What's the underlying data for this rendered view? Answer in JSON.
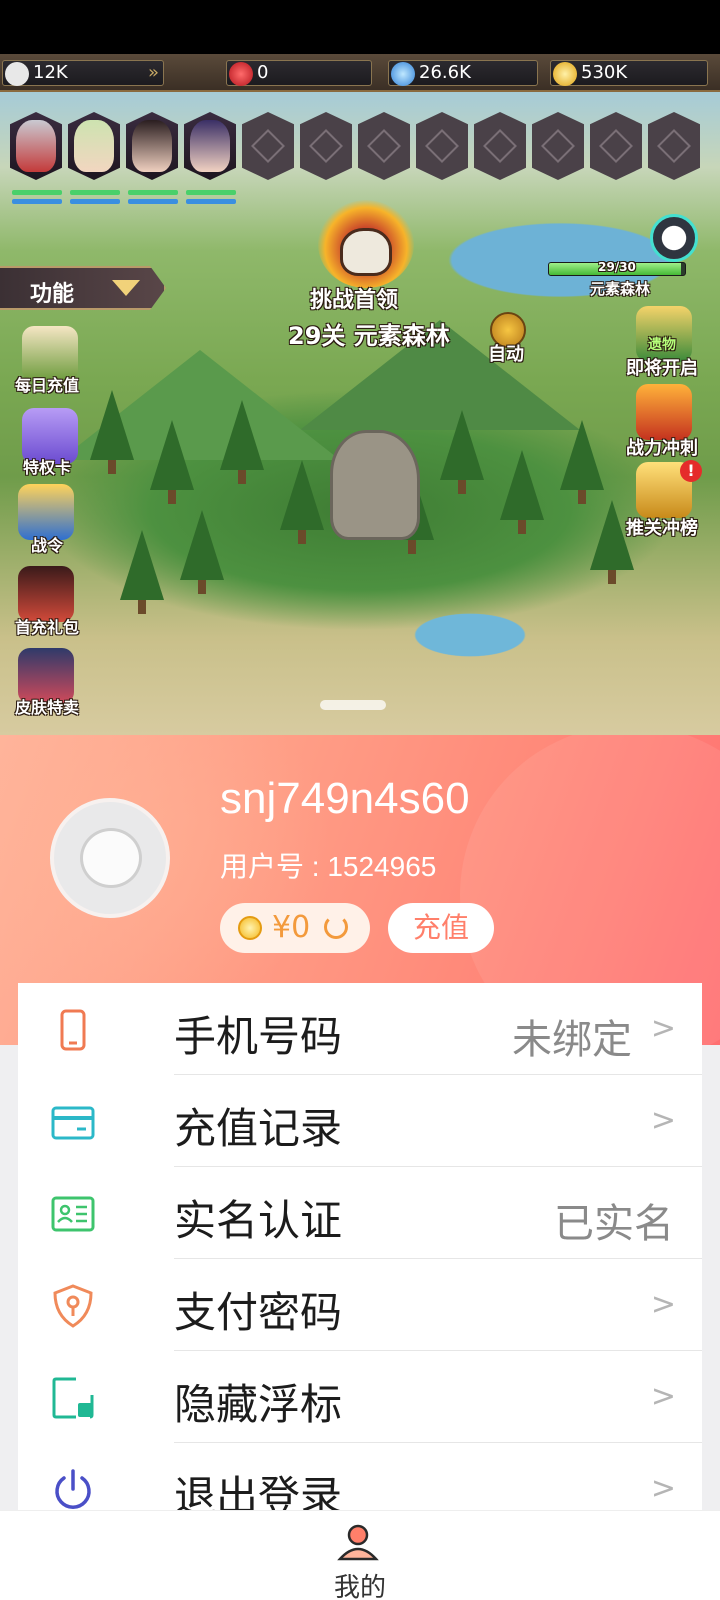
{
  "resources": {
    "power": "12K",
    "rubies": "0",
    "diamonds": "26.6K",
    "gold": "530K"
  },
  "game": {
    "menu_label": "功能",
    "boss_title": "挑战首领",
    "stage_text": "29关 元素森林",
    "auto_label": "自动",
    "progress_text": "29/30",
    "progress_fraction": 0.967,
    "zone_name": "元素森林",
    "left_icons": [
      "每日充值",
      "特权卡",
      "战令",
      "首充礼包",
      "皮肤特卖"
    ],
    "right_icons": [
      "即将开启",
      "战力冲刺",
      "推关冲榜"
    ],
    "relic_badge": "遗物"
  },
  "profile": {
    "username": "snj749n4s60",
    "user_id": "用户号 : 1524965",
    "balance": "¥0",
    "recharge_label": "充值"
  },
  "menu": [
    {
      "label": "手机号码",
      "value": "未绑定",
      "icon": "phone-icon",
      "color": "#f07a52"
    },
    {
      "label": "充值记录",
      "value": "",
      "icon": "card-icon",
      "color": "#2bb8c8"
    },
    {
      "label": "实名认证",
      "value": "已实名",
      "icon": "id-card-icon",
      "color": "#3ec46d"
    },
    {
      "label": "支付密码",
      "value": "",
      "icon": "shield-key-icon",
      "color": "#f08a5a"
    },
    {
      "label": "隐藏浮标",
      "value": "",
      "icon": "float-hide-icon",
      "color": "#20b894"
    },
    {
      "label": "退出登录",
      "value": "",
      "icon": "power-icon",
      "color": "#4a4fc7"
    }
  ],
  "tab": {
    "me_label": "我的"
  },
  "colors": {
    "accent": "#ff7f6a",
    "header_start": "#ffb49b",
    "header_end": "#ff6f71"
  }
}
